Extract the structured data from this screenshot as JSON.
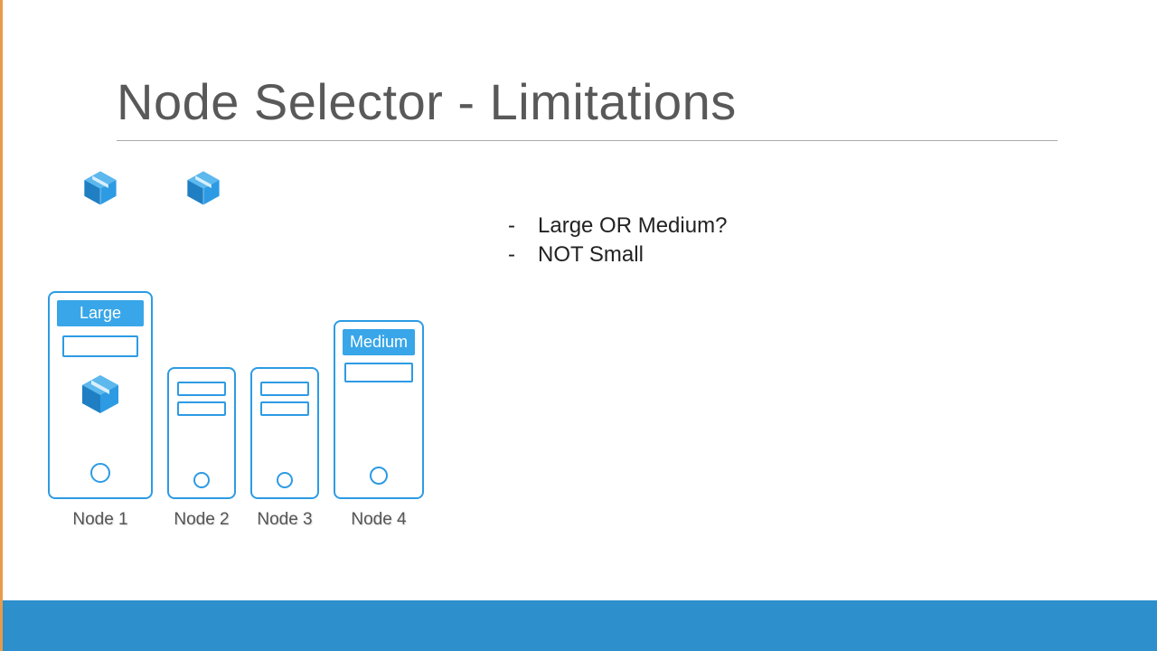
{
  "title": "Node Selector - Limitations",
  "bullets": {
    "item1": "Large OR Medium?",
    "item2": "NOT Small"
  },
  "labels": {
    "large": "Large",
    "medium": "Medium"
  },
  "nodes": {
    "n1": "Node 1",
    "n2": "Node 2",
    "n3": "Node 3",
    "n4": "Node 4"
  },
  "colors": {
    "accent": "#2d9be4",
    "footer": "#2d8fcc"
  }
}
